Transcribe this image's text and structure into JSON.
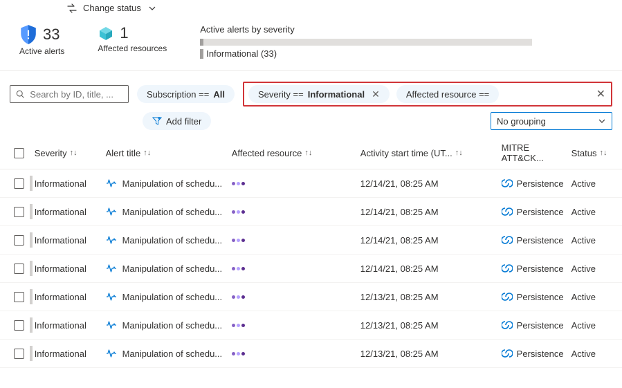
{
  "topbar": {
    "change_status": "Change status"
  },
  "summary": {
    "alerts_count": "33",
    "alerts_label": "Active alerts",
    "resources_count": "1",
    "resources_label": "Affected resources",
    "severity_title": "Active alerts by severity",
    "severity_item": "Informational (33)"
  },
  "filters": {
    "search_placeholder": "Search by ID, title, ...",
    "sub_pill_prefix": "Subscription == ",
    "sub_pill_value": "All",
    "sev_pill_prefix": "Severity == ",
    "sev_pill_value": "Informational",
    "res_pill": "Affected resource ==",
    "add_filter": "Add filter",
    "grouping": "No grouping"
  },
  "columns": {
    "severity": "Severity",
    "title": "Alert title",
    "resource": "Affected resource",
    "time": "Activity start time (UT...",
    "mitre": "MITRE ATT&CK...",
    "status": "Status"
  },
  "rows": [
    {
      "severity": "Informational",
      "title": "Manipulation of schedu...",
      "time": "12/14/21, 08:25 AM",
      "mitre": "Persistence",
      "status": "Active"
    },
    {
      "severity": "Informational",
      "title": "Manipulation of schedu...",
      "time": "12/14/21, 08:25 AM",
      "mitre": "Persistence",
      "status": "Active"
    },
    {
      "severity": "Informational",
      "title": "Manipulation of schedu...",
      "time": "12/14/21, 08:25 AM",
      "mitre": "Persistence",
      "status": "Active"
    },
    {
      "severity": "Informational",
      "title": "Manipulation of schedu...",
      "time": "12/14/21, 08:25 AM",
      "mitre": "Persistence",
      "status": "Active"
    },
    {
      "severity": "Informational",
      "title": "Manipulation of schedu...",
      "time": "12/13/21, 08:25 AM",
      "mitre": "Persistence",
      "status": "Active"
    },
    {
      "severity": "Informational",
      "title": "Manipulation of schedu...",
      "time": "12/13/21, 08:25 AM",
      "mitre": "Persistence",
      "status": "Active"
    },
    {
      "severity": "Informational",
      "title": "Manipulation of schedu...",
      "time": "12/13/21, 08:25 AM",
      "mitre": "Persistence",
      "status": "Active"
    }
  ]
}
